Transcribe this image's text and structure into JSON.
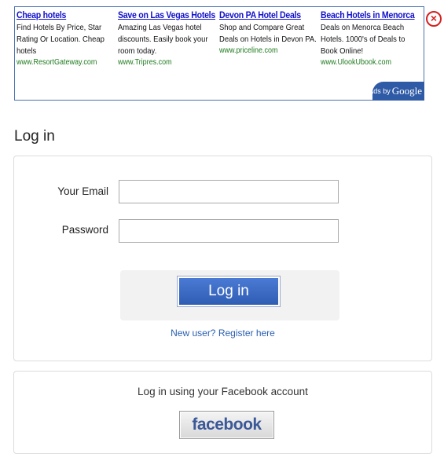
{
  "ads": {
    "items": [
      {
        "title": "Cheap hotels",
        "description": "Find Hotels By Price, Star Rating Or Location. Cheap hotels",
        "url": "www.ResortGateway.com"
      },
      {
        "title": "Save on Las Vegas Hotels",
        "description": "Amazing Las Vegas hotel discounts. Easily book your room today.",
        "url": "www.Tripres.com"
      },
      {
        "title": "Devon PA Hotel Deals",
        "description": "Shop and Compare Great Deals on Hotels in Devon PA.",
        "url": "www.priceline.com"
      },
      {
        "title": "Beach Hotels in Menorca",
        "description": "Deals on Menorca Beach Hotels. 1000's of Deals to Book Online!",
        "url": "www.UlookUbook.com"
      }
    ],
    "ads_by_label": "Ads by",
    "ads_by_brand": "Google",
    "close_icon": "close-circle-icon",
    "close_glyph": "×"
  },
  "page": {
    "title": "Log in"
  },
  "login": {
    "email_label": "Your Email",
    "email_value": "",
    "password_label": "Password",
    "password_value": "",
    "submit_label": "Log in",
    "register_link": "New user? Register here"
  },
  "facebook": {
    "prompt": "Log in using your Facebook account",
    "button_label": "facebook"
  },
  "colors": {
    "ad_title": "#1111cc",
    "ad_url": "#1e7a1e",
    "primary_button": "#3d6cc6",
    "link": "#2a5fb0",
    "facebook_brand": "#3b5998",
    "close_icon": "#d42020"
  }
}
